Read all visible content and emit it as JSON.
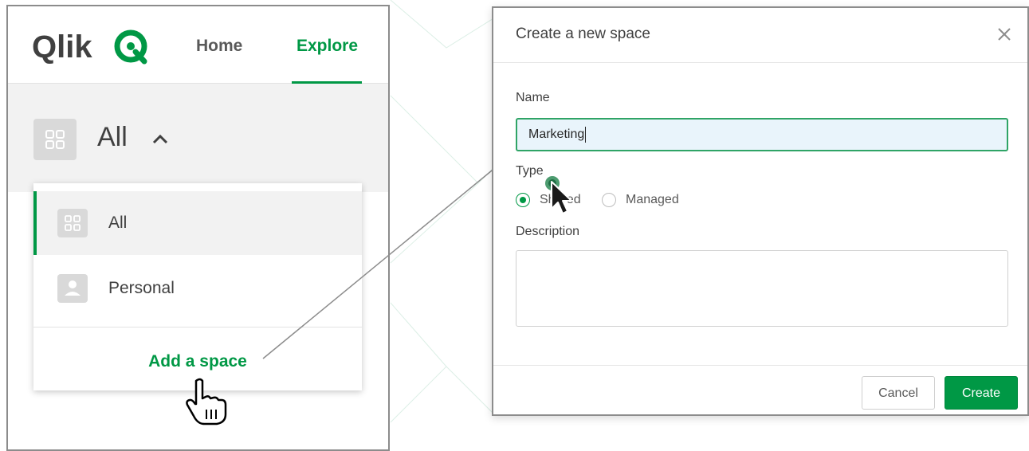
{
  "brand": {
    "logo_text": "Qlik",
    "accent_color": "#009845"
  },
  "nav": {
    "tabs": [
      {
        "label": "Home",
        "active": false
      },
      {
        "label": "Explore",
        "active": true
      }
    ]
  },
  "space_selector": {
    "current": "All",
    "icon": "grid-icon",
    "chevron": "chevron-up-icon",
    "items": [
      {
        "label": "All",
        "icon": "grid-icon",
        "selected": true
      },
      {
        "label": "Personal",
        "icon": "person-icon",
        "selected": false
      }
    ],
    "add_label": "Add a space"
  },
  "dialog": {
    "title": "Create a new space",
    "close_icon": "close-icon",
    "name_label": "Name",
    "name_value": "Marketing",
    "type_label": "Type",
    "type_options": [
      {
        "label": "Shared",
        "checked": true
      },
      {
        "label": "Managed",
        "checked": false
      }
    ],
    "description_label": "Description",
    "description_value": "",
    "cancel_label": "Cancel",
    "create_label": "Create"
  }
}
